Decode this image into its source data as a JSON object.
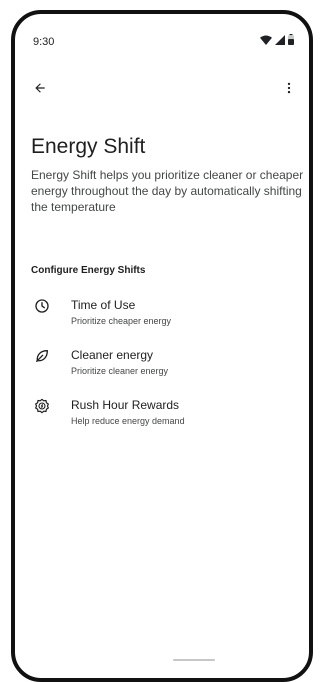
{
  "status_bar": {
    "time": "9:30",
    "icons": [
      "wifi-icon",
      "cellular-signal-icon",
      "battery-icon"
    ]
  },
  "app_bar": {
    "back_icon": "arrow-back-icon",
    "menu_icon": "more-vert-icon"
  },
  "page": {
    "title": "Energy Shift",
    "description": "Energy Shift helps you prioritize cleaner or cheaper energy throughout the day by automatically shifting the temperature"
  },
  "section": {
    "header": "Configure Energy Shifts",
    "items": [
      {
        "icon": "clock-icon",
        "title": "Time of Use",
        "subtitle": "Prioritize cheaper energy"
      },
      {
        "icon": "leaf-icon",
        "title": "Cleaner energy",
        "subtitle": "Prioritize cleaner energy"
      },
      {
        "icon": "energy-badge-icon",
        "title": "Rush Hour Rewards",
        "subtitle": "Help reduce energy demand"
      }
    ]
  },
  "colors": {
    "primary_text": "#1f1f1f",
    "secondary_text": "#444746",
    "frame": "#111111",
    "background": "#ffffff"
  }
}
